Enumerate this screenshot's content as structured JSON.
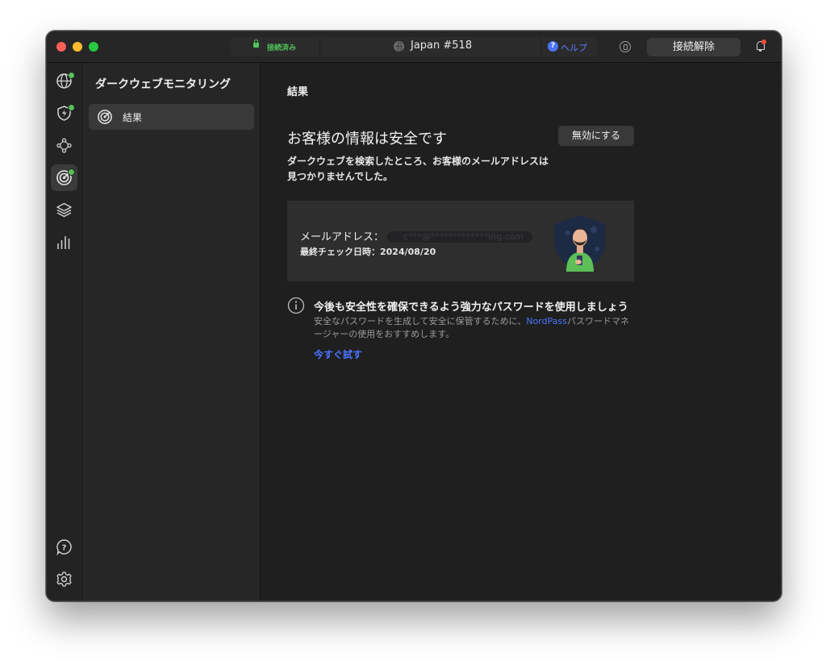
{
  "window": {
    "status_text": "接続済み",
    "server_name": "Japan #518",
    "help_label": "ヘルプ",
    "disconnect_label": "接続解除"
  },
  "sidebar": {
    "title": "ダークウェブモニタリング",
    "items": [
      {
        "label": "結果",
        "icon": "radar-icon",
        "active": true
      }
    ]
  },
  "iconbar": {
    "items": [
      {
        "icon": "globe-icon",
        "status": "green-dot"
      },
      {
        "icon": "threat-protection-icon",
        "status": "green-dot"
      },
      {
        "icon": "meshnet-icon"
      },
      {
        "icon": "dark-web-monitor-icon",
        "status": "green-dot",
        "active": true
      },
      {
        "icon": "layers-icon"
      },
      {
        "icon": "stats-icon"
      }
    ],
    "bottom": [
      {
        "icon": "help-icon"
      },
      {
        "icon": "settings-icon"
      }
    ]
  },
  "main": {
    "breadcrumb": "結果",
    "headline": "お客様の情報は安全です",
    "disable_label": "無効にする",
    "description": "ダークウェブを検索したところ、お客様のメールアドレスは見つかりませんでした。",
    "card": {
      "email_label": "メールアドレス：",
      "email_value_redacted": "c***@*************ing.com",
      "last_check_label": "最終チェック日時：",
      "last_check_value": "2024/08/20"
    },
    "tip": {
      "title": "今後も安全性を確保できるよう強力なパスワードを使用しましょう",
      "body_before": "安全なパスワードを生成して安全に保管するために、",
      "body_link": "NordPass",
      "body_after": "パスワードマネージャーの使用をおすすめします。",
      "cta": "今すぐ試す"
    }
  },
  "colors": {
    "accent": "#4b74ff",
    "success": "#52c25a",
    "background": "#1f1f1f",
    "notification": "#ff4d3a"
  }
}
